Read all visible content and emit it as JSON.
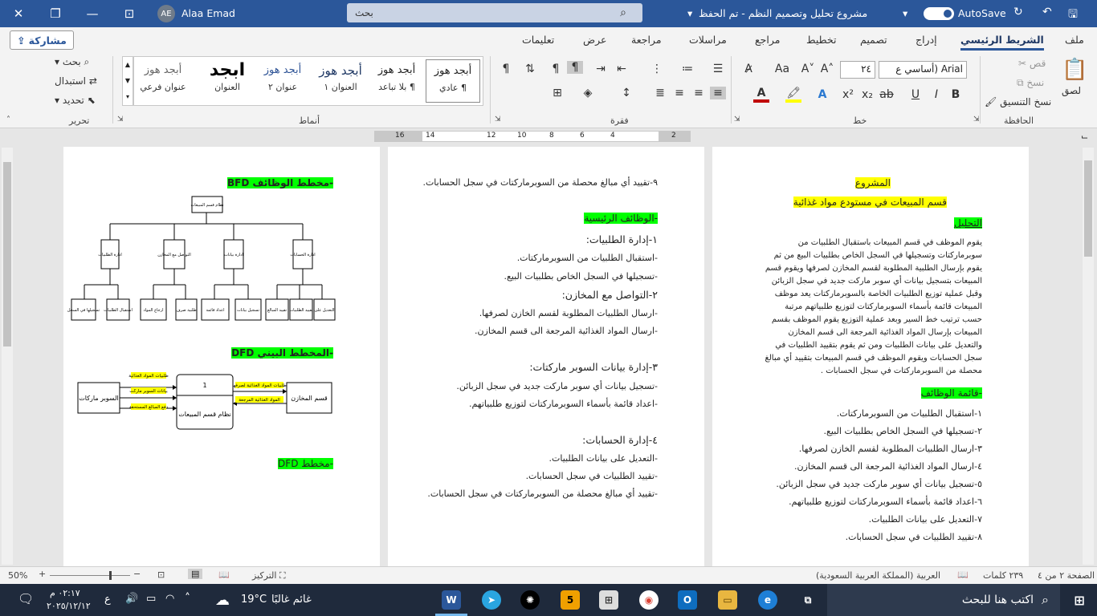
{
  "titlebar": {
    "doc_title": "مشروع تحليل وتصميم النظم - تم الحفظ",
    "search": "بحث",
    "user": "Alaa Emad",
    "initials": "AE",
    "autosave": "AutoSave"
  },
  "tabs": [
    "ملف",
    "الشريط الرئيسي",
    "إدراج",
    "تصميم",
    "تخطيط",
    "مراجع",
    "مراسلات",
    "مراجعة",
    "عرض",
    "تعليمات"
  ],
  "share": "مشاركة",
  "ribbon": {
    "clipboard": {
      "paste": "لصق",
      "cut": "قص",
      "copy": "نسخ",
      "format_painter": "نسخ التنسيق",
      "label": "الحافظة"
    },
    "font": {
      "name": "Arial (أساسي ع",
      "size": "٢٤",
      "label": "خط"
    },
    "paragraph": {
      "label": "فقرة"
    },
    "styles": {
      "label": "أنماط",
      "items": [
        {
          "preview": "أبجد هوز",
          "name": "¶ عادي"
        },
        {
          "preview": "أبجد هوز",
          "name": "¶ بلا تباعد"
        },
        {
          "preview": "أبجد هوز",
          "name": "العنوان ١"
        },
        {
          "preview": "أبجد هوز",
          "name": "عنوان ٢"
        },
        {
          "preview": "ابجد",
          "name": "العنوان"
        },
        {
          "preview": "أبجد هوز",
          "name": "عنوان فرعي"
        }
      ]
    },
    "editing": {
      "find": "بحث",
      "replace": "استبدال",
      "select": "تحديد",
      "label": "تحرير"
    }
  },
  "ruler": [
    "2",
    "4",
    "6",
    "8",
    "10",
    "12",
    "14",
    "16"
  ],
  "page1": {
    "heading": "المشروع",
    "subheading": "قسم المبيعات في مستودع مواد غذائية",
    "analysis": "التحليل",
    "paragraph": [
      "يقوم الموظف في قسم المبيعات باستقبال الطلبيات من",
      "سوبرماركتات وتسجيلها في السجل الخاص بطلبيات البيع من ثم",
      "يقوم بإرسال الطلبية المطلوبة لقسم المخازن لصرفها ويقوم قسم",
      "المبيعات بتسجيل بيانات أي سوبر ماركت جديد في سجل الزبائن",
      "وقبل عملية توزيع الطلبيات الخاصة بالسوبرماركتات يعد موظف",
      "المبيعات قائمة بأسماء السوبرماركتات لتوزيع طلبياتهم مرتبة",
      "حسب ترتيب خط السير وبعد عملية التوزيع يقوم الموظف بقسم",
      "المبيعات بإرسال المواد الغذائية المرجعة الى قسم المخازن",
      "والتعديل على بيانات الطلبيات ومن ثم يقوم بتقييد الطلبيات في",
      "سجل الحسابات  ويقوم الموظف في قسم المبيعات بتقييد أي مبالغ",
      "محصلة من السوبرماركتات في سجل الحسابات ."
    ],
    "list_title": "-قائمة الوظائف",
    "list": [
      "١-استقبال الطلبيات من السوبرماركتات.",
      "٢-تسجيلها في السجل الخاص بطلبيات البيع.",
      "٣-ارسال الطلبيات المطلوبة لقسم الخازن لصرفها.",
      "٤-ارسال المواد الغذائية المرجعة الى قسم المخازن.",
      "٥-تسجيل بيانات أي سوبر ماركت جديد في سجل الزبائن.",
      "٦-اعداد قائمة بأسماء السوبرماركتات لتوزيع طلبياتهم.",
      "٧-التعديل على بيانات الطلبيات.",
      "٨-تقييد الطلبيات في سجل الحسابات."
    ]
  },
  "page2": {
    "top": "٩-تقييد أي مبالغ محصلة من السوبرماركتات في سجل الحسابات.",
    "main_title": "-الوظائف الرئيسية",
    "g1": "١-إدارة الطلبيات:",
    "g1_items": [
      "-استقبال الطلبيات من السوبرماركتات.",
      "-تسجيلها في السجل الخاص بطلبيات البيع."
    ],
    "g2": "٢-التواصل مع المخازن:",
    "g2_items": [
      "-ارسال الطلبيات المطلوبة لقسم الخازن لصرفها.",
      "-ارسال المواد الغذائية المرجعة الى قسم المخازن."
    ],
    "g3": "٣-إدارة بيانات السوبر ماركتات:",
    "g3_items": [
      "-تسجيل بيانات أي سوبر ماركت جديد في سجل الزبائن.",
      "-اعداد قائمة بأسماء السوبرماركتات لتوزيع طلبياتهم."
    ],
    "g4": "٤-إدارة الحسابات:",
    "g4_items": [
      "-التعديل على بيانات الطلبيات.",
      "-تقييد الطلبيات في سجل الحسابات.",
      "-تقييد أي مبالغ محصلة من السوبرماركتات في سجل الحسابات."
    ]
  },
  "page3": {
    "bfd_title": "-مخطط الوظائف BFD",
    "bfd_root": "نظام قسم المبيعات",
    "bfd_l1": [
      "ادارة الطلبيات",
      "التواصل مع المخازن",
      "ادارة بيانات السوبر ماركات",
      "ادارة الحسابات"
    ],
    "bfd_l2": [
      "تسجيلها في السجل",
      "استقبال الطلبيات",
      "ارجاع المواد الغذائية",
      "طلبية صرف",
      "اعداد قائمة باسماء السوبرماركات",
      "تسجيل بيانات السوبرماركات",
      "تقييد المبالغ المحصلة",
      "تقييد الطلبيات في الحسابات",
      "التعديل على بيانات الطلبيات"
    ],
    "dfd_title": "-المخطط البيني DFD",
    "dfd_left": "السوبر ماركات",
    "dfd_center_num": "1",
    "dfd_center": "نظام قسم المبيعات",
    "dfd_right": "قسم المخازن",
    "dfd_left_flows": [
      "طلبيات المواد الغذائية",
      "بيانات السوبر ماركت",
      "دفع المبالغ المستحقة"
    ],
    "dfd_right_flows": [
      "طلبيات المواد الغذائية لصرفها",
      "المواد الغذائية المرجعة"
    ],
    "dfd2_title": "-مخطط DFD"
  },
  "status": {
    "page": "الصفحة ٢ من ٤",
    "words": "٢٣٩ كلمات",
    "lang": "العربية (المملكة العربية السعودية)",
    "focus": "التركيز",
    "zoom": "50%"
  },
  "taskbar": {
    "search": "اكتب هنا للبحث",
    "weather": "غائم غالبًا",
    "temp": "19°C",
    "time": "٠٢:١٧ م",
    "date": "٢٠٢٥/١٢/١٢",
    "lang": "ع"
  }
}
